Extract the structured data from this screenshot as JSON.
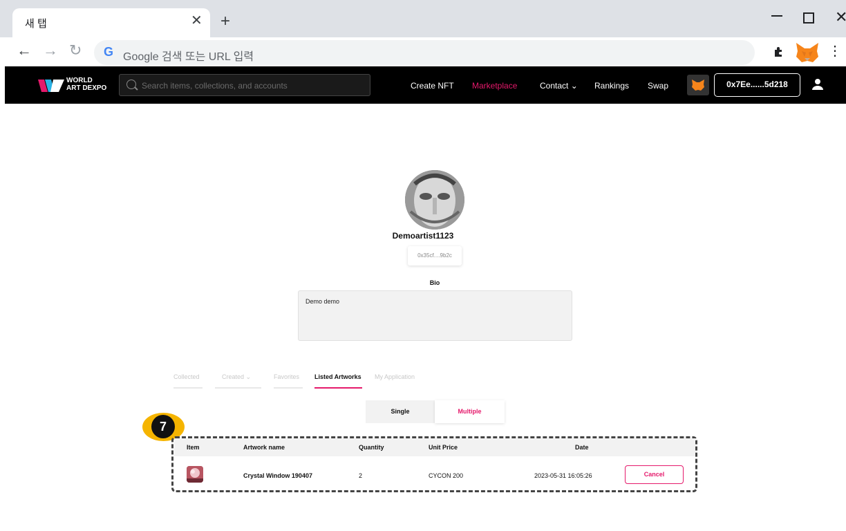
{
  "browser": {
    "tab_title": "새 탭",
    "tab_close": "✕",
    "new_tab": "+",
    "omnibox_placeholder": "Google 검색 또는 URL 입력",
    "google_glyph": "G"
  },
  "header": {
    "logo_line1": "WORLD",
    "logo_line2": "ART DEXPO",
    "search_placeholder": "Search items, collections, and accounts",
    "nav": {
      "create": "Create NFT",
      "marketplace": "Marketplace",
      "contact": "Contact ⌄",
      "rankings": "Rankings",
      "swap": "Swap"
    },
    "wallet_address": "0x7Ee......5d218"
  },
  "profile": {
    "username": "Demoartist1123",
    "address": "0x35cf....9b2c",
    "bio_label": "Bio",
    "bio_text": "Demo demo"
  },
  "profile_tabs": {
    "collected": "Collected",
    "created": "Created ⌄",
    "favorites": "Favorites",
    "listed": "Listed Artworks",
    "application": "My Application"
  },
  "segment": {
    "single": "Single",
    "multiple": "Multiple"
  },
  "badge": "7",
  "table": {
    "headers": {
      "item": "Item",
      "name": "Artwork name",
      "quantity": "Quantity",
      "price": "Unit Price",
      "date": "Date"
    },
    "rows": [
      {
        "name": "Crystal Window 190407",
        "quantity": "2",
        "price": "CYCON 200",
        "date": "2023-05-31 16:05:26",
        "action": "Cancel"
      }
    ]
  },
  "colors": {
    "accent": "#e5196b",
    "badge": "#f5b400",
    "header_bg": "#000000"
  }
}
